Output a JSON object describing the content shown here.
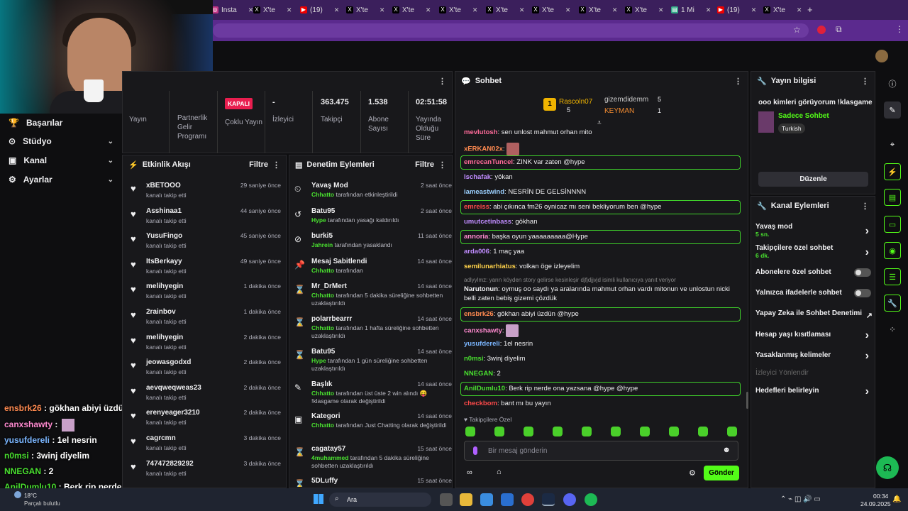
{
  "browser": {
    "tabs": [
      "Insta",
      "X'te",
      "(19)",
      "X'te",
      "X'te",
      "X'te",
      "X'te",
      "X'te",
      "X'te",
      "X'te",
      "1 Mi",
      "(19)",
      "X'te"
    ]
  },
  "nav": {
    "items": [
      {
        "label": "Başarılar"
      },
      {
        "label": "Stüdyo"
      },
      {
        "label": "Kanal"
      },
      {
        "label": "Ayarlar"
      }
    ]
  },
  "stats": {
    "items": [
      {
        "value": "",
        "label": "Yayın"
      },
      {
        "value": "",
        "label": "Partnerlik Gelir Programı"
      },
      {
        "value": "KAPALI",
        "label": "Çoklu Yayın"
      },
      {
        "value": "-",
        "label": "İzleyici"
      },
      {
        "value": "363.475",
        "label": "Takipçi"
      },
      {
        "value": "1.538",
        "label": "Abone Sayısı"
      },
      {
        "value": "02:51:58",
        "label": "Yayında Olduğu Süre"
      }
    ]
  },
  "activity": {
    "title": "Etkinlik Akışı",
    "filter": "Filtre",
    "items": [
      {
        "name": "xBETOOO",
        "desc": "kanalı takip etti",
        "time": "29 saniye önce"
      },
      {
        "name": "Asshinaa1",
        "desc": "kanalı takip etti",
        "time": "44 saniye önce"
      },
      {
        "name": "YusuFingo",
        "desc": "kanalı takip etti",
        "time": "45 saniye önce"
      },
      {
        "name": "ItsBerkayy",
        "desc": "kanalı takip etti",
        "time": "49 saniye önce"
      },
      {
        "name": "melihyegin",
        "desc": "kanalı takip etti",
        "time": "1 dakika önce"
      },
      {
        "name": "2rainbov",
        "desc": "kanalı takip etti",
        "time": "1 dakika önce"
      },
      {
        "name": "melihyegin",
        "desc": "kanalı takip etti",
        "time": "2 dakika önce"
      },
      {
        "name": "jeowasgodxd",
        "desc": "kanalı takip etti",
        "time": "2 dakika önce"
      },
      {
        "name": "aevqweqweas23",
        "desc": "kanalı takip etti",
        "time": "2 dakika önce"
      },
      {
        "name": "erenyeager3210",
        "desc": "kanalı takip etti",
        "time": "2 dakika önce"
      },
      {
        "name": "cagrcmn",
        "desc": "kanalı takip etti",
        "time": "3 dakika önce"
      },
      {
        "name": "747472829292",
        "desc": "kanalı takip etti",
        "time": "3 dakika önce"
      }
    ]
  },
  "moderation": {
    "title": "Denetim Eylemleri",
    "filter": "Filtre",
    "items": [
      {
        "name": "Yavaş Mod",
        "user": "Chhatto",
        "desc": " tarafından etkinleştirildi",
        "time": "2 saat önce",
        "icon": "⏲"
      },
      {
        "name": "Batu95",
        "user": "Hype",
        "desc": " tarafından yasağı kaldırıldı",
        "time": "2 saat önce",
        "icon": "↺"
      },
      {
        "name": "burki5",
        "user": "Jahrein",
        "desc": " tarafından yasaklandı",
        "time": "11 saat önce",
        "icon": "⊘"
      },
      {
        "name": "Mesaj Sabitlendi",
        "user": "Chhatto",
        "desc": " tarafından",
        "time": "14 saat önce",
        "icon": "📌"
      },
      {
        "name": "Mr_DrMert",
        "user": "Chhatto",
        "desc": " tarafından 5 dakika süreliğine sohbetten uzaklaştırıldı",
        "time": "14 saat önce",
        "icon": "⌛"
      },
      {
        "name": "polarrbearrr",
        "user": "Chhatto",
        "desc": " tarafından 1 hafta süreliğine sohbetten uzaklaştırıldı",
        "time": "14 saat önce",
        "icon": "⌛"
      },
      {
        "name": "Batu95",
        "user": "Hype",
        "desc": " tarafından 1 gün süreliğine sohbetten uzaklaştırıldı",
        "time": "14 saat önce",
        "icon": "⌛"
      },
      {
        "name": "Başlık",
        "user": "Chhatto",
        "desc": " tarafından üst üste 2 win alındı 😝 !klasgame olarak değiştirildi",
        "time": "14 saat önce",
        "icon": "✎"
      },
      {
        "name": "Kategori",
        "user": "Chhatto",
        "desc": " tarafından Just Chatting olarak değiştirildi",
        "time": "14 saat önce",
        "icon": "▣"
      },
      {
        "name": "cagatay57",
        "user": "4muhammed",
        "desc": " tarafından 5 dakika süreliğine sohbetten uzaklaştırıldı",
        "time": "15 saat önce",
        "icon": "⌛"
      },
      {
        "name": "5DLuffy",
        "user": "",
        "desc": "",
        "time": "15 saat önce",
        "icon": "⌛"
      }
    ]
  },
  "chat": {
    "title": "Sohbet",
    "leaders": [
      {
        "name": "Rascoln07",
        "count": "5"
      },
      {
        "name": "gizemdidemm",
        "count": "5"
      },
      {
        "name": "KEYMAN",
        "count": "1"
      }
    ],
    "messages": [
      {
        "user": "mevlutosh",
        "text": "sen unlost mahmut orhan mito",
        "color": "#ff6b9a",
        "hl": false
      },
      {
        "user": "xERKAN02x",
        "text": "",
        "color": "#ff8a50",
        "hl": false
      },
      {
        "user": "emrecanTuncel",
        "text": "ZINK var zaten @hype",
        "color": "#ff6b9a",
        "hl": true
      },
      {
        "user": "lschafak",
        "text": "yökan",
        "color": "#c08cff",
        "hl": false
      },
      {
        "user": "iameastwind",
        "text": "NESRİN DE GELSİNNNN",
        "color": "#9bd0ff",
        "hl": false
      },
      {
        "user": "emreiss",
        "text": "abi çıkınca fm26 oynicaz mı seni bekliyorum ben @hype",
        "color": "#ff4a4a",
        "hl": true
      },
      {
        "user": "umutcetinbass",
        "text": "gökhan",
        "color": "#c08cff",
        "hl": false
      },
      {
        "user": "annoria",
        "text": "başka oyun yaaaaaaaaa@Hype",
        "color": "#ff8ad0",
        "hl": true
      },
      {
        "user": "arda006",
        "text": "1 maç yaa",
        "color": "#c08cff",
        "hl": false
      },
      {
        "user": "semilunarhiatus",
        "text": "volkan öge izleyelim",
        "color": "#ffd24a",
        "hl": false
      },
      {
        "user": "Narutonun",
        "text": "oymuş oo saydı ya aralarında mahmut orhan vardı mitonun ve unlostun nicki belli zaten bebiş gizemi çözdük",
        "color": "#efeff1",
        "hl": false
      },
      {
        "user": "ensbrk26",
        "text": "gökhan abiyi üzdün @hype",
        "color": "#ff8a50",
        "hl": true
      },
      {
        "user": "canxshawty",
        "text": "",
        "color": "#ff8ad0",
        "hl": false
      },
      {
        "user": "yusufdereli",
        "text": "1el nesrin",
        "color": "#7bb6ff",
        "hl": false
      },
      {
        "user": "n0msi",
        "text": "3winj diyelim",
        "color": "#49e02f",
        "hl": false
      },
      {
        "user": "NNEGAN",
        "text": "2",
        "color": "#49e02f",
        "hl": false
      },
      {
        "user": "AnilDumlu10",
        "text": "Berk rip nerde ona yazsana @hype @hype",
        "color": "#49e02f",
        "hl": true
      },
      {
        "user": "checkbom",
        "text": "bant mı bu yayın",
        "color": "#ff4a4a",
        "hl": false
      }
    ],
    "reply_note": "adlyylmz: yarın köyden story gelirse kesinleşir djfjdjjvjd isimli kullanıcıya yanıt veriyor",
    "followers_only": "Takipçilere Özel",
    "placeholder": "Bir mesaj gönderin",
    "send": "Gönder"
  },
  "stream_info": {
    "title": "Yayın bilgisi",
    "stream_title": "ooo kimleri görüyorum !klasgame",
    "category": "Sadece Sohbet",
    "tag": "Turkish",
    "edit": "Düzenle"
  },
  "channel_actions": {
    "title": "Kanal Eylemleri",
    "items": [
      {
        "label": "Yavaş mod",
        "sub": "5 sn.",
        "kind": "arrow"
      },
      {
        "label": "Takipçilere özel sohbet",
        "sub": "6 dk.",
        "kind": "arrow"
      },
      {
        "label": "Abonelere özel sohbet",
        "sub": "",
        "kind": "toggle"
      },
      {
        "label": "Yalnızca ifadelerle sohbet",
        "sub": "",
        "kind": "toggle"
      },
      {
        "label": "Yapay Zeka ile Sohbet Denetimi",
        "sub": "",
        "kind": "ext"
      },
      {
        "label": "Hesap yaşı kısıtlaması",
        "sub": "",
        "kind": "arrow"
      },
      {
        "label": "Yasaklanmış kelimeler",
        "sub": "",
        "kind": "arrow"
      },
      {
        "label": "İzleyici Yönlendir",
        "sub": "",
        "kind": "disabled"
      },
      {
        "label": "Hedefleri belirleyin",
        "sub": "",
        "kind": "arrow"
      }
    ]
  },
  "overlay": {
    "lines": [
      {
        "user": "ensbrk26",
        "text": " : gökhan abiyi üzdün @hype",
        "color": "#ff8a50"
      },
      {
        "user": "canxshawty",
        "text": " :",
        "color": "#ff8ad0"
      },
      {
        "user": "yusufdereli",
        "text": " : 1el nesrin",
        "color": "#7bb6ff"
      },
      {
        "user": "n0msi",
        "text": " : 3winj diyelim",
        "color": "#49e02f"
      },
      {
        "user": "NNEGAN",
        "text": " : 2",
        "color": "#49e02f"
      },
      {
        "user": "AnilDumlu10",
        "text": " : Berk rip nerde ona yazsana @hype @hype",
        "color": "#49e02f"
      }
    ]
  },
  "taskbar": {
    "weather_temp": "18°C",
    "weather_desc": "Parçalı bulutlu",
    "search": "Ara",
    "time": "00:34",
    "date": "24.09.2025"
  }
}
